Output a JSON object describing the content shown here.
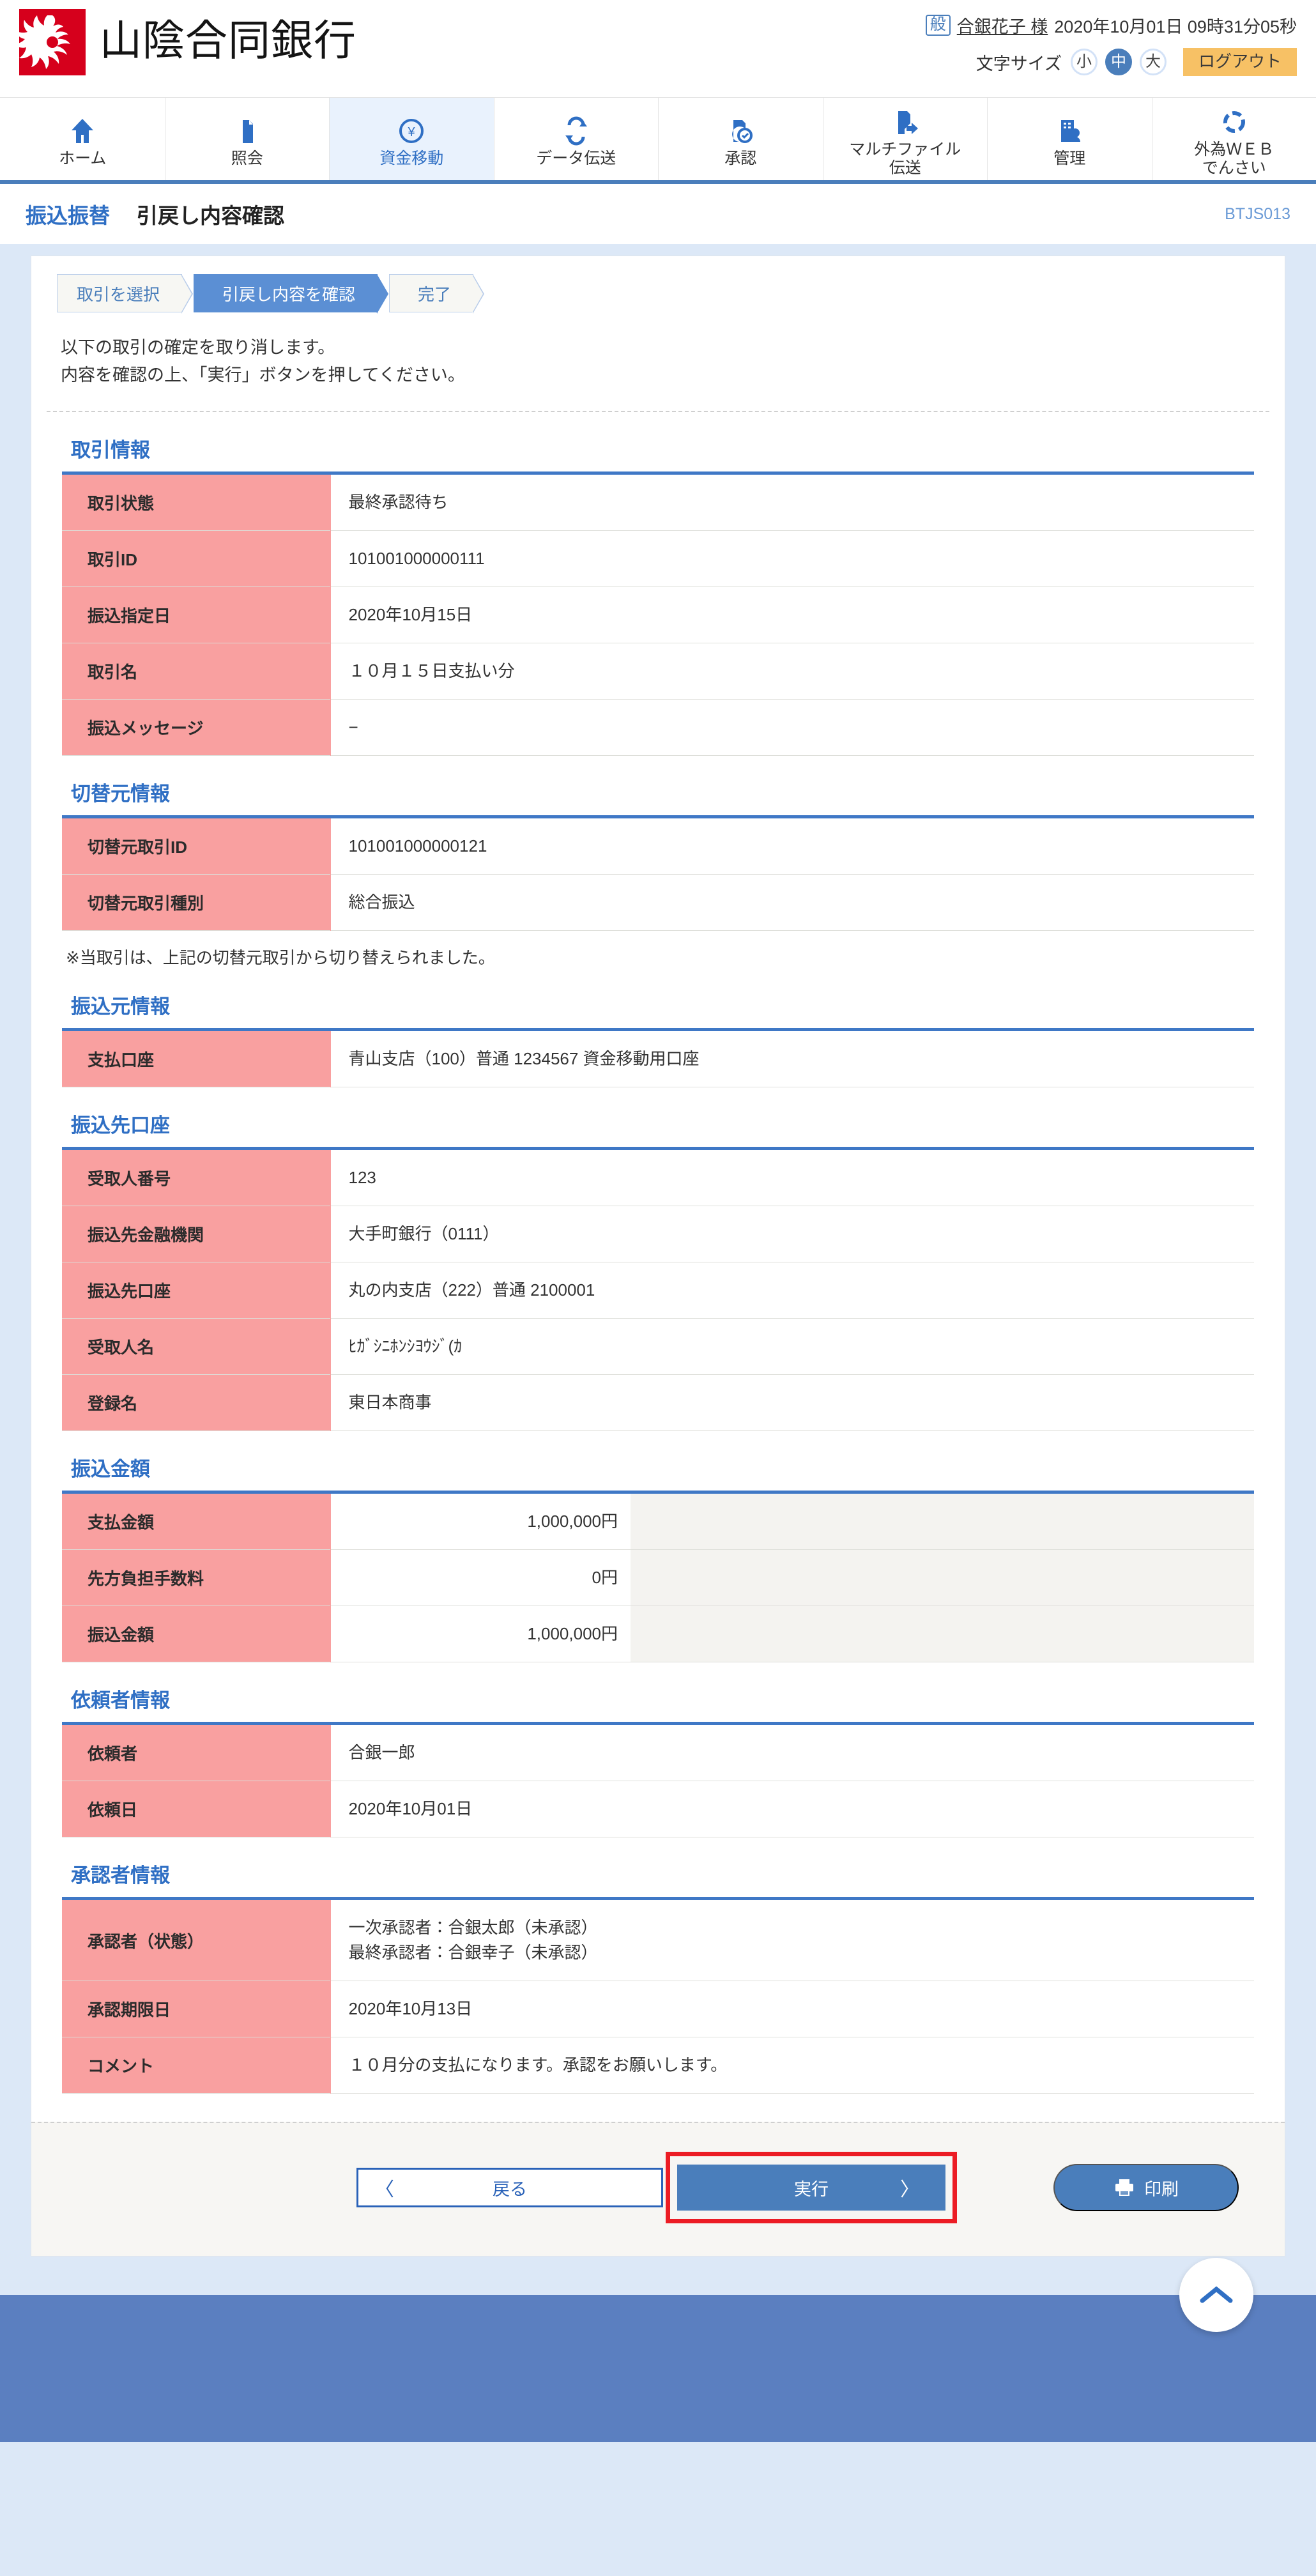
{
  "header": {
    "bank_name": "山陰合同銀行",
    "user_badge": "般",
    "user_name": "合銀花子 様",
    "login_time": "2020年10月01日 09時31分05秒",
    "font_size_label": "文字サイズ",
    "font_size_options": [
      "小",
      "中",
      "大"
    ],
    "font_size_selected": "中",
    "logout_label": "ログアウト"
  },
  "gnav": {
    "items": [
      {
        "label": "ホーム",
        "icon": "home-icon",
        "active": false
      },
      {
        "label": "照会",
        "icon": "inquiry-icon",
        "active": false
      },
      {
        "label": "資金移動",
        "icon": "transfer-icon",
        "active": true
      },
      {
        "label": "データ伝送",
        "icon": "data-transmission-icon",
        "active": false
      },
      {
        "label": "承認",
        "icon": "approval-icon",
        "active": false
      },
      {
        "label": "マルチファイル\n伝送",
        "icon": "multifile-icon",
        "active": false
      },
      {
        "label": "管理",
        "icon": "management-icon",
        "active": false
      },
      {
        "label": "外為ＷＥＢ\nでんさい",
        "icon": "forex-web-icon",
        "active": false
      }
    ]
  },
  "titlebar": {
    "category": "振込振替",
    "page_title": "引戻し内容確認",
    "screen_id": "BTJS013"
  },
  "steps": [
    {
      "label": "取引を選択",
      "active": false
    },
    {
      "label": "引戻し内容を確認",
      "active": true
    },
    {
      "label": "完了",
      "active": false
    }
  ],
  "intro": {
    "line1": "以下の取引の確定を取り消します。",
    "line2": "内容を確認の上、「実行」ボタンを押してください。"
  },
  "sections": [
    {
      "heading": "取引情報",
      "rows": [
        {
          "label": "取引状態",
          "value": "最終承認待ち"
        },
        {
          "label": "取引ID",
          "value": "101001000000111"
        },
        {
          "label": "振込指定日",
          "value": "2020年10月15日"
        },
        {
          "label": "取引名",
          "value": "１０月１５日支払い分"
        },
        {
          "label": "振込メッセージ",
          "value": "−"
        }
      ]
    },
    {
      "heading": "切替元情報",
      "rows": [
        {
          "label": "切替元取引ID",
          "value": "101001000000121"
        },
        {
          "label": "切替元取引種別",
          "value": "総合振込"
        }
      ],
      "note": "※当取引は、上記の切替元取引から切り替えられました。"
    },
    {
      "heading": "振込元情報",
      "rows": [
        {
          "label": "支払口座",
          "value": "青山支店（100）普通 1234567 資金移動用口座"
        }
      ]
    },
    {
      "heading": "振込先口座",
      "rows": [
        {
          "label": "受取人番号",
          "value": "123"
        },
        {
          "label": "振込先金融機関",
          "value": "大手町銀行（0111）"
        },
        {
          "label": "振込先口座",
          "value": "丸の内支店（222）普通 2100001"
        },
        {
          "label": "受取人名",
          "value": "ﾋｶﾞｼﾆﾎﾝｼﾖｳｼﾞ(ｶ"
        },
        {
          "label": "登録名",
          "value": "東日本商事"
        }
      ]
    },
    {
      "heading": "振込金額",
      "amount_style": true,
      "rows": [
        {
          "label": "支払金額",
          "value": "1,000,000円"
        },
        {
          "label": "先方負担手数料",
          "value": "0円"
        },
        {
          "label": "振込金額",
          "value": "1,000,000円"
        }
      ]
    },
    {
      "heading": "依頼者情報",
      "rows": [
        {
          "label": "依頼者",
          "value": "合銀一郎"
        },
        {
          "label": "依頼日",
          "value": "2020年10月01日"
        }
      ]
    },
    {
      "heading": "承認者情報",
      "rows": [
        {
          "label": "承認者（状態）",
          "value": "一次承認者：合銀太郎（未承認）\n最終承認者：合銀幸子（未承認）"
        },
        {
          "label": "承認期限日",
          "value": "2020年10月13日"
        },
        {
          "label": "コメント",
          "value": "１０月分の支払になります。承認をお願いします。"
        }
      ]
    }
  ],
  "buttons": {
    "back_label": "戻る",
    "back_chevron": "〈",
    "exec_label": "実行",
    "exec_chevron": "〉",
    "print_label": "印刷"
  },
  "colors": {
    "accent_blue": "#4a7ebb",
    "label_pink": "#f9a0a0",
    "logo_red": "#d6001c",
    "logout_orange": "#f7c165",
    "highlight_red": "#ec1c24",
    "page_bg": "#dce8f7",
    "footer_blue": "#5b7fc0"
  }
}
